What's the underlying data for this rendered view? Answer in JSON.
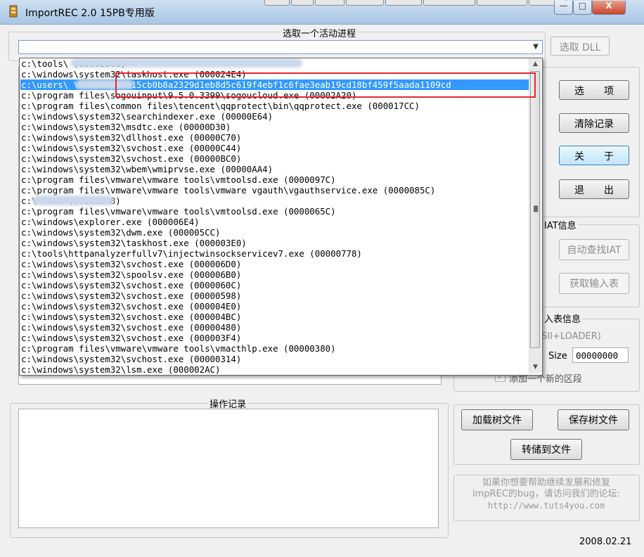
{
  "window": {
    "title": "ImportREC 2.0 15PB专用版",
    "min_label": "—",
    "max_label": "□",
    "close_label": "X"
  },
  "process_group": {
    "label": "选取一个活动进程",
    "pick_dll_button": "选取 DLL"
  },
  "right_buttons": {
    "options": "选　　项",
    "clear_log": "清除记录",
    "about": "关　　于",
    "exit": "退　　出"
  },
  "iat_group": {
    "label": "IAT信息",
    "auto_find": "自动查找IAT",
    "get_imports": "获取输入表"
  },
  "imports_group": {
    "label": "入表信息",
    "hint": "SII+LOADER)",
    "size_label": "Size",
    "size_value": "00000000",
    "add_section_label": "添加一个新的区段"
  },
  "tree_buttons": {
    "load": "加载树文件",
    "save": "保存树文件",
    "dump": "转储到文件"
  },
  "log_group": {
    "label": "操作记录"
  },
  "info_text": {
    "line1": "如果你想要帮助继续发展和修复",
    "line2": "impREC的bug，请访问我们的论坛:",
    "line3": "http://www.tuts4you.com"
  },
  "date": "2008.02.21",
  "processes": [
    {
      "text": "c:\\tools\\                                 (000029CC)"
    },
    {
      "text": "c:\\windows\\system32\\taskhost.exe (000024E4)"
    },
    {
      "text": "c:\\users\\          \\desktop\\5e15cb0b8a2329d1eb8d5c619f4ebf1c6fae3eab19cd18bf459f5aada1109cd",
      "selected": true
    },
    {
      "text": "c:\\program files\\sogouinput\\9.5.0.3399\\sogoucloud.exe (00002A20)"
    },
    {
      "text": "c:\\program files\\common files\\tencent\\qqprotect\\bin\\qqprotect.exe (000017CC)"
    },
    {
      "text": "c:\\windows\\system32\\searchindexer.exe (00000E64)"
    },
    {
      "text": "c:\\windows\\system32\\msdtc.exe (00000D30)"
    },
    {
      "text": "c:\\windows\\system32\\dllhost.exe (00000C70)"
    },
    {
      "text": "c:\\windows\\system32\\svchost.exe (00000C44)"
    },
    {
      "text": "c:\\windows\\system32\\svchost.exe (00000BC0)"
    },
    {
      "text": "c:\\windows\\system32\\wbem\\wmiprvse.exe (00000AA4)"
    },
    {
      "text": "c:\\program files\\vmware\\vmware tools\\vmtoolsd.exe (0000097C)"
    },
    {
      "text": "c:\\program files\\vmware\\vmware tools\\vmware vgauth\\vgauthservice.exe (0000085C)"
    },
    {
      "text": "c:\\             .exe (000002A8)"
    },
    {
      "text": "c:\\program files\\vmware\\vmware tools\\vmtoolsd.exe (0000065C)"
    },
    {
      "text": "c:\\windows\\explorer.exe (000006E4)"
    },
    {
      "text": "c:\\windows\\system32\\dwm.exe (000005CC)"
    },
    {
      "text": "c:\\windows\\system32\\taskhost.exe (000003E0)"
    },
    {
      "text": "c:\\tools\\httpanalyzerfullv7\\injectwinsockservicev7.exe (00000778)"
    },
    {
      "text": "c:\\windows\\system32\\svchost.exe (000006D0)"
    },
    {
      "text": "c:\\windows\\system32\\spoolsv.exe (000006B0)"
    },
    {
      "text": "c:\\windows\\system32\\svchost.exe (0000060C)"
    },
    {
      "text": "c:\\windows\\system32\\svchost.exe (00000598)"
    },
    {
      "text": "c:\\windows\\system32\\svchost.exe (000004E0)"
    },
    {
      "text": "c:\\windows\\system32\\svchost.exe (000004BC)"
    },
    {
      "text": "c:\\windows\\system32\\svchost.exe (00000480)"
    },
    {
      "text": "c:\\windows\\system32\\svchost.exe (000003F4)"
    },
    {
      "text": "c:\\program files\\vmware\\vmware tools\\vmacthlp.exe (00000380)"
    },
    {
      "text": "c:\\windows\\system32\\svchost.exe (00000314)"
    },
    {
      "text": "c:\\windows\\system32\\lsm.exe (000002AC)"
    }
  ]
}
